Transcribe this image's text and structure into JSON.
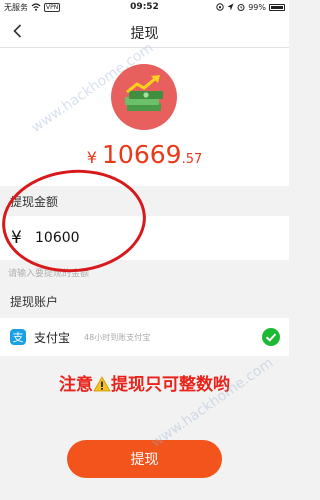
{
  "status_bar": {
    "carrier": "无服务",
    "vpn": "VPN",
    "time": "09:52",
    "battery": "99%",
    "battery_level": 0.99
  },
  "nav": {
    "title": "提现",
    "back_icon": "back-arrow-icon"
  },
  "balance": {
    "currency": "¥",
    "integer": "10669",
    "decimal": ".57",
    "color": "#e8391b"
  },
  "amount_section": {
    "label": "提现金额",
    "currency": "¥",
    "value": "10600",
    "hint": "请输入要提现的金额"
  },
  "account_section": {
    "label": "提现账户",
    "method_icon": "alipay-icon",
    "method_icon_glyph": "支",
    "method": "支付宝",
    "note": "48小时到账支付宝",
    "selected_icon": "check-circle-icon"
  },
  "notice": {
    "before": "注意",
    "after": "提现只可整数哟"
  },
  "submit": {
    "label": "提现"
  },
  "watermark": "www.hackhome.com",
  "colors": {
    "accent": "#f2541c",
    "selected": "#1db935",
    "alipay": "#1aa0e5"
  }
}
